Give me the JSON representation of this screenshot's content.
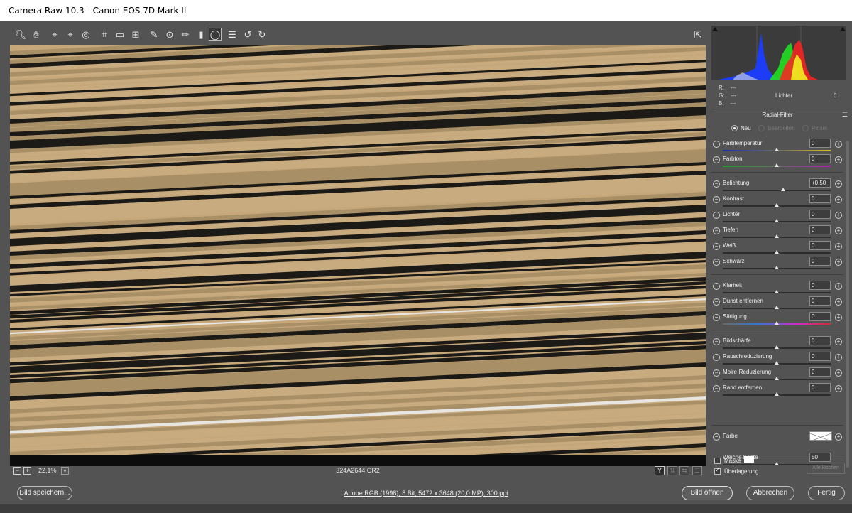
{
  "window": {
    "title": "Camera Raw 10.3 - Canon EOS 7D Mark II"
  },
  "toolbar": {
    "tools": [
      {
        "name": "zoom-tool-icon",
        "glyph": "🔍︎"
      },
      {
        "name": "hand-tool-icon",
        "glyph": "✋︎"
      },
      {
        "name": "white-balance-tool-icon",
        "glyph": "⌖"
      },
      {
        "name": "color-sampler-tool-icon",
        "glyph": "⌖"
      },
      {
        "name": "targeted-adjustment-tool-icon",
        "glyph": "◎"
      },
      {
        "name": "crop-tool-icon",
        "glyph": "⌗"
      },
      {
        "name": "straighten-tool-icon",
        "glyph": "▭"
      },
      {
        "name": "transform-tool-icon",
        "glyph": "⊞"
      },
      {
        "name": "spot-removal-tool-icon",
        "glyph": "✎"
      },
      {
        "name": "red-eye-tool-icon",
        "glyph": "⊙"
      },
      {
        "name": "adjustment-brush-icon",
        "glyph": "✏︎"
      },
      {
        "name": "graduated-filter-icon",
        "glyph": "▮"
      },
      {
        "name": "radial-filter-icon",
        "glyph": "◯"
      },
      {
        "name": "preferences-icon",
        "glyph": "☰"
      },
      {
        "name": "rotate-left-icon",
        "glyph": "↺"
      },
      {
        "name": "rotate-right-icon",
        "glyph": "↻"
      }
    ],
    "fullscreen_glyph": "⇱"
  },
  "canvas": {
    "filename": "324A2644.CR2",
    "zoom": "22,1%",
    "zoom_out": "−",
    "zoom_in": "+",
    "view_y": "Y"
  },
  "histogram": {
    "r_label": "R:",
    "r_val": "---",
    "g_label": "G:",
    "g_val": "---",
    "b_label": "B:",
    "b_val": "---",
    "info_label": "Lichter",
    "info_value": "0"
  },
  "panel": {
    "title": "Radial-Filter",
    "modes": [
      "Neu",
      "Bearbeiten",
      "Pinsel"
    ]
  },
  "sliders": [
    {
      "label": "Farbtemperatur",
      "value": "0",
      "pos": 0.5,
      "track": "temp"
    },
    {
      "label": "Farbton",
      "value": "0",
      "pos": 0.5,
      "track": "tint"
    },
    {
      "label": "Belichtung",
      "value": "+0,50",
      "pos": 0.56,
      "track": "plain"
    },
    {
      "label": "Kontrast",
      "value": "0",
      "pos": 0.5,
      "track": "plain"
    },
    {
      "label": "Lichter",
      "value": "0",
      "pos": 0.5,
      "track": "plain"
    },
    {
      "label": "Tiefen",
      "value": "0",
      "pos": 0.5,
      "track": "plain"
    },
    {
      "label": "Weiß",
      "value": "0",
      "pos": 0.5,
      "track": "plain"
    },
    {
      "label": "Schwarz",
      "value": "0",
      "pos": 0.5,
      "track": "plain"
    },
    {
      "label": "Klarheit",
      "value": "0",
      "pos": 0.5,
      "track": "plain"
    },
    {
      "label": "Dunst entfernen",
      "value": "0",
      "pos": 0.5,
      "track": "plain"
    },
    {
      "label": "Sättigung",
      "value": "0",
      "pos": 0.5,
      "track": "sat"
    },
    {
      "label": "Bildschärfe",
      "value": "0",
      "pos": 0.5,
      "track": "plain"
    },
    {
      "label": "Rauschreduzierung",
      "value": "0",
      "pos": 0.5,
      "track": "plain"
    },
    {
      "label": "Moire-Reduzierung",
      "value": "0",
      "pos": 0.5,
      "track": "plain"
    },
    {
      "label": "Rand entfernen",
      "value": "0",
      "pos": 0.5,
      "track": "plain"
    }
  ],
  "color_row": {
    "label": "Farbe"
  },
  "feather": {
    "label": "Weiche Kante",
    "value": "50",
    "pos": 0.5
  },
  "mask": {
    "mask_label": "Maske",
    "overlay_label": "Überlagerung",
    "clear_all": "Alle löschen"
  },
  "bottom": {
    "save": "Bild speichern...",
    "workflow": "Adobe RGB (1998); 8 Bit; 5472 x 3648 (20,0 MP); 300 ppi",
    "open": "Bild öffnen",
    "cancel": "Abbrechen",
    "done": "Fertig"
  },
  "colors": {
    "stripe_light": "#c6a77a",
    "stripe_mid": "#a88f66",
    "stripe_dark": "#1c1a17",
    "stripe_white": "#e8e6e2"
  }
}
